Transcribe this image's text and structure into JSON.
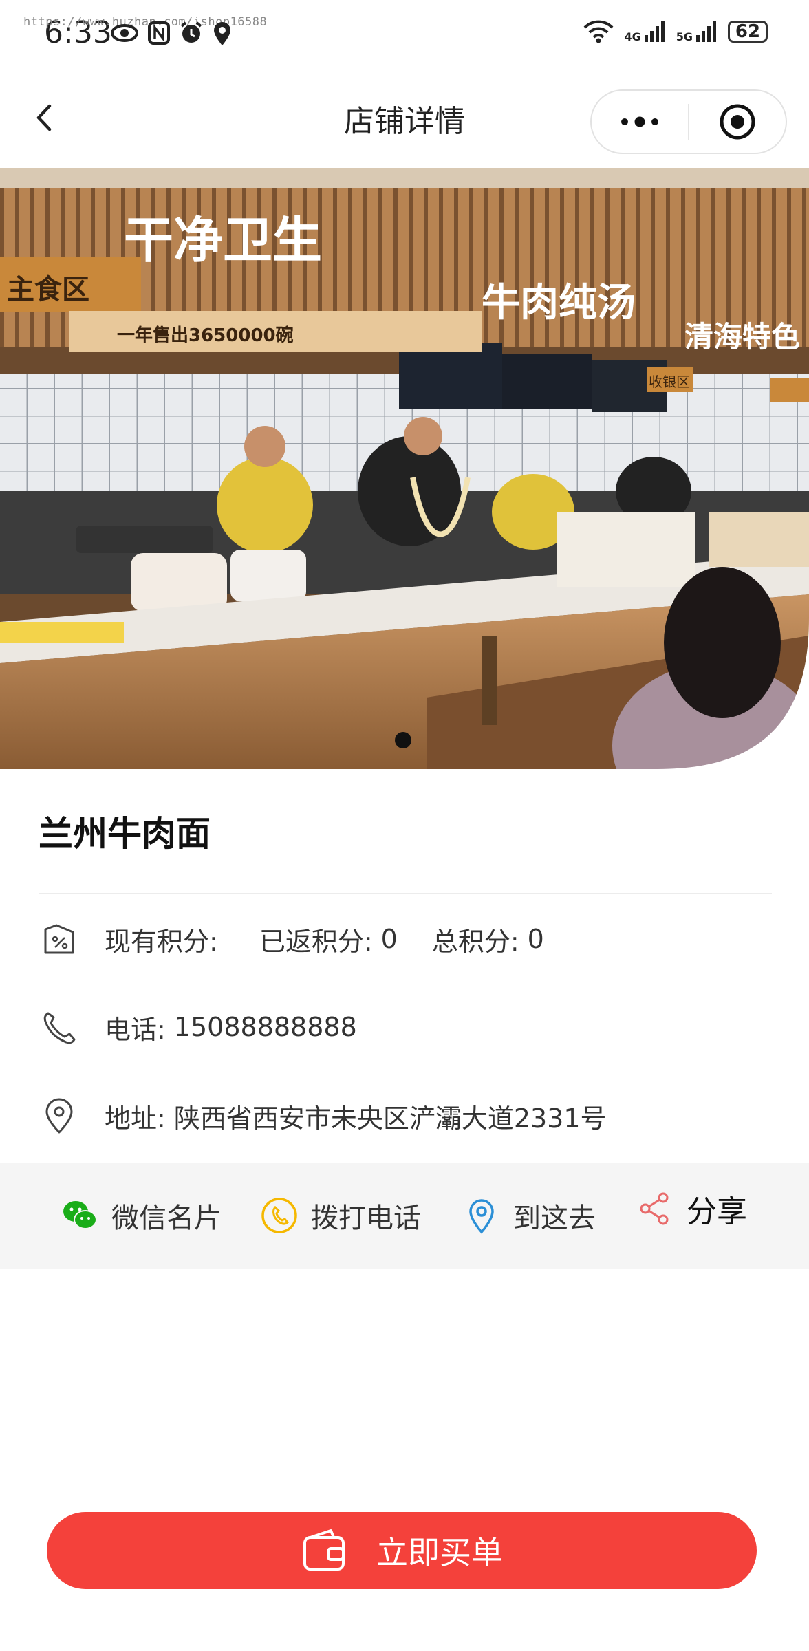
{
  "status_bar": {
    "watermark": "https://www.huzhan.com/ishop16588",
    "time": "6:33",
    "net1": "4G",
    "net2": "5G",
    "battery": "62"
  },
  "navbar": {
    "title": "店铺详情"
  },
  "hero": {
    "slides_total": 1,
    "active_slide": 1,
    "sign_texts": [
      "干净卫生",
      "牛肉纯汤",
      "主食区",
      "一年售出3650000碗",
      "收银区",
      "清海特色"
    ]
  },
  "shop": {
    "name": "兰州牛肉面",
    "points_label": "现有积分:",
    "points_value": "",
    "returned_label": "已返积分:",
    "returned_value": "0",
    "total_label": "总积分:",
    "total_value": "0",
    "phone_label": "电话:",
    "phone_value": "15088888888",
    "address_label": "地址:",
    "address_value": "陕西省西安市未央区浐灞大道2331号"
  },
  "actions": {
    "wechat_card": "微信名片",
    "call": "拨打电话",
    "navigate": "到这去",
    "share": "分享"
  },
  "buy_button": {
    "label": "立即买单"
  },
  "colors": {
    "accent": "#f4413b",
    "wechat": "#1aad19",
    "phone": "#f5b800",
    "location": "#2b8fd6",
    "share": "#e86a6a"
  }
}
